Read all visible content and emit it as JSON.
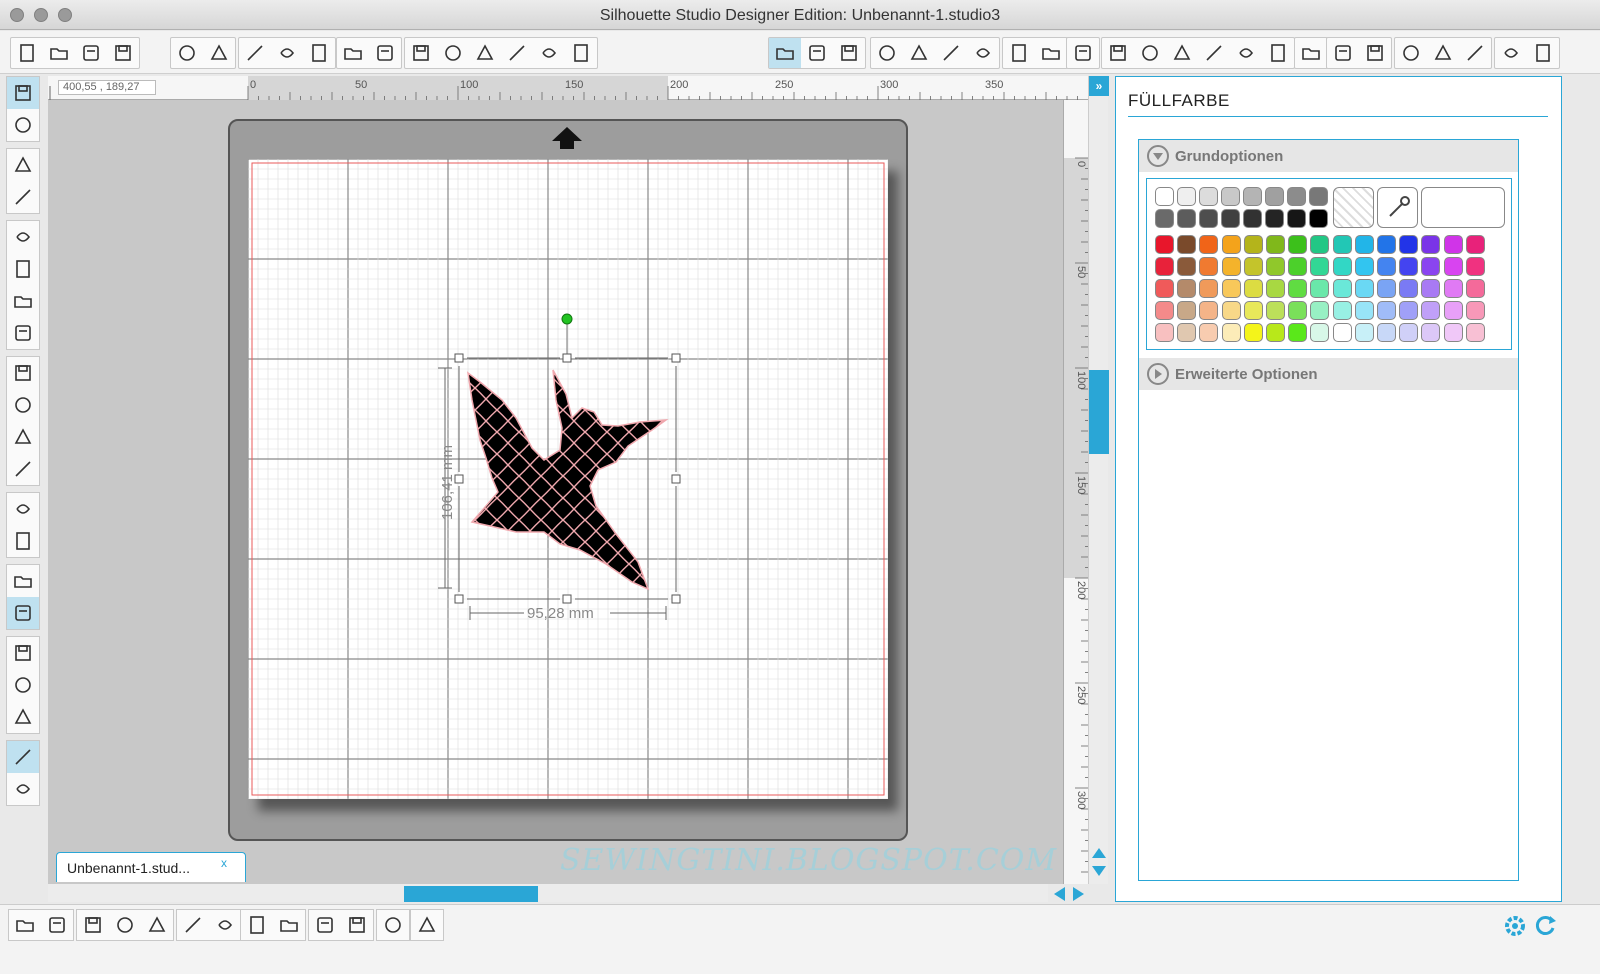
{
  "window": {
    "title": "Silhouette Studio Designer Edition: Unbenannt-1.studio3"
  },
  "canvas": {
    "coordinates": "400,55 , 189,27",
    "h_ruler_labels": [
      "0",
      "50",
      "100",
      "150",
      "200",
      "250",
      "300",
      "350"
    ],
    "v_ruler_labels": [
      "0",
      "50",
      "100",
      "150",
      "200",
      "250",
      "300"
    ],
    "width_label": "95,28 mm",
    "height_label": "106,41 mm",
    "document_tab": "Unbenannt-1.stud...",
    "tab_close": "x",
    "watermark": "SEWINGTINI.BLOGSPOT.COM"
  },
  "panel": {
    "title": "FÜLLFARBE",
    "section_basic": "Grundoptionen",
    "section_advanced": "Erweiterte Optionen"
  },
  "colors": {
    "accent": "#2aa6d6",
    "shape_fill": "#000000",
    "shape_pattern_stroke": "#f0a8ae",
    "selection_handle_rotate": "#22c322"
  },
  "swatches": {
    "grays_row1": [
      "#ffffff",
      "#efefef",
      "#dcdcdc",
      "#c8c8c8",
      "#b4b4b4",
      "#a0a0a0",
      "#8c8c8c",
      "#787878"
    ],
    "grays_row2": [
      "#6a6a6a",
      "#5c5c5c",
      "#4e4e4e",
      "#404040",
      "#323232",
      "#242424",
      "#161616",
      "#000000"
    ],
    "color_rows": [
      [
        "#e8162b",
        "#7a4a2b",
        "#f06418",
        "#f4a31b",
        "#b4b41b",
        "#80b81b",
        "#3cc01b",
        "#22c785",
        "#22c7b5",
        "#22b5e8",
        "#2274e8",
        "#2234e8",
        "#7a34e8",
        "#d034e8",
        "#e8227a"
      ],
      [
        "#e8223a",
        "#8a5a3a",
        "#f07a30",
        "#f4b32b",
        "#c4c42b",
        "#90c82b",
        "#4cd02b",
        "#32d795",
        "#32d7c5",
        "#32c5f0",
        "#4484f0",
        "#4444f0",
        "#8a44f0",
        "#d844f0",
        "#f03280"
      ],
      [
        "#f05a5a",
        "#b48a6a",
        "#f09a5a",
        "#f8c85a",
        "#dcdc42",
        "#a8d842",
        "#60dc42",
        "#6ae8aa",
        "#6ae8d8",
        "#6ad8f4",
        "#7aa4f4",
        "#7a7af4",
        "#a87af4",
        "#e07af4",
        "#f46a9a"
      ],
      [
        "#f48a8a",
        "#c8a888",
        "#f4b488",
        "#f8d888",
        "#e8e85a",
        "#bce05a",
        "#7ae05a",
        "#98f0c4",
        "#98f0e4",
        "#98e4f8",
        "#a0bcf8",
        "#a0a0f8",
        "#c0a0f8",
        "#e8a0f8",
        "#f898b8"
      ],
      [
        "#f8c0c0",
        "#e0c8b0",
        "#f8ccb0",
        "#fcecb8",
        "#f4f41a",
        "#b8e81a",
        "#5ae81a",
        "#d8f8e8",
        "#ffffff",
        "#c8f0f8",
        "#c8d8f8",
        "#d0d0f8",
        "#dcc8f8",
        "#f0c8f8",
        "#f8c0d4"
      ]
    ]
  },
  "icons": {
    "top_toolbar": [
      "new-doc-icon",
      "open-icon",
      "open-library-icon",
      "save-icon",
      "save-library-icon",
      "print-icon",
      "send-icon",
      "copy-icon",
      "paste-icon",
      "cut-icon",
      "undo-icon",
      "redo-icon",
      "pan-icon",
      "zoom-in-icon",
      "zoom-out-icon",
      "zoom-box-icon",
      "fit-icon",
      "fit-page-icon",
      "fill-color-icon",
      "gradient-icon",
      "pattern-icon",
      "line-color-icon",
      "line-style-icon",
      "line-thickness-icon",
      "stroke-icon",
      "stroke-style-icon",
      "text-icon",
      "transform-icon",
      "rotate-icon",
      "scale-icon",
      "shear-icon",
      "align-icon",
      "replicate-icon",
      "modify-icon",
      "offset-icon",
      "trace-icon",
      "page-setup-icon",
      "grid-icon",
      "cut-settings-icon",
      "eraser-icon"
    ],
    "left_tools": [
      "select-icon",
      "point-edit-icon",
      "line-icon",
      "rectangle-icon",
      "rounded-rect-icon",
      "ellipse-icon",
      "polygon-icon",
      "curve-icon",
      "freehand-icon",
      "smooth-freehand-icon",
      "arc-icon",
      "regular-polygon-icon",
      "text-tool-icon",
      "eraser-tool-icon",
      "knife-icon",
      "design-view-icon",
      "library-icon",
      "store-icon",
      "single-view-icon",
      "split-view-icon"
    ],
    "bottom_tools": [
      "group-icon",
      "ungroup-icon",
      "compound-icon",
      "release-compound-icon",
      "weld-icon",
      "subtract-icon",
      "intersect-icon",
      "divide-icon",
      "bring-front-icon",
      "send-back-icon",
      "cloud-icon",
      "target-icon",
      "paint-icon",
      "book-icon",
      "settings-gear-icon",
      "refresh-icon"
    ]
  }
}
